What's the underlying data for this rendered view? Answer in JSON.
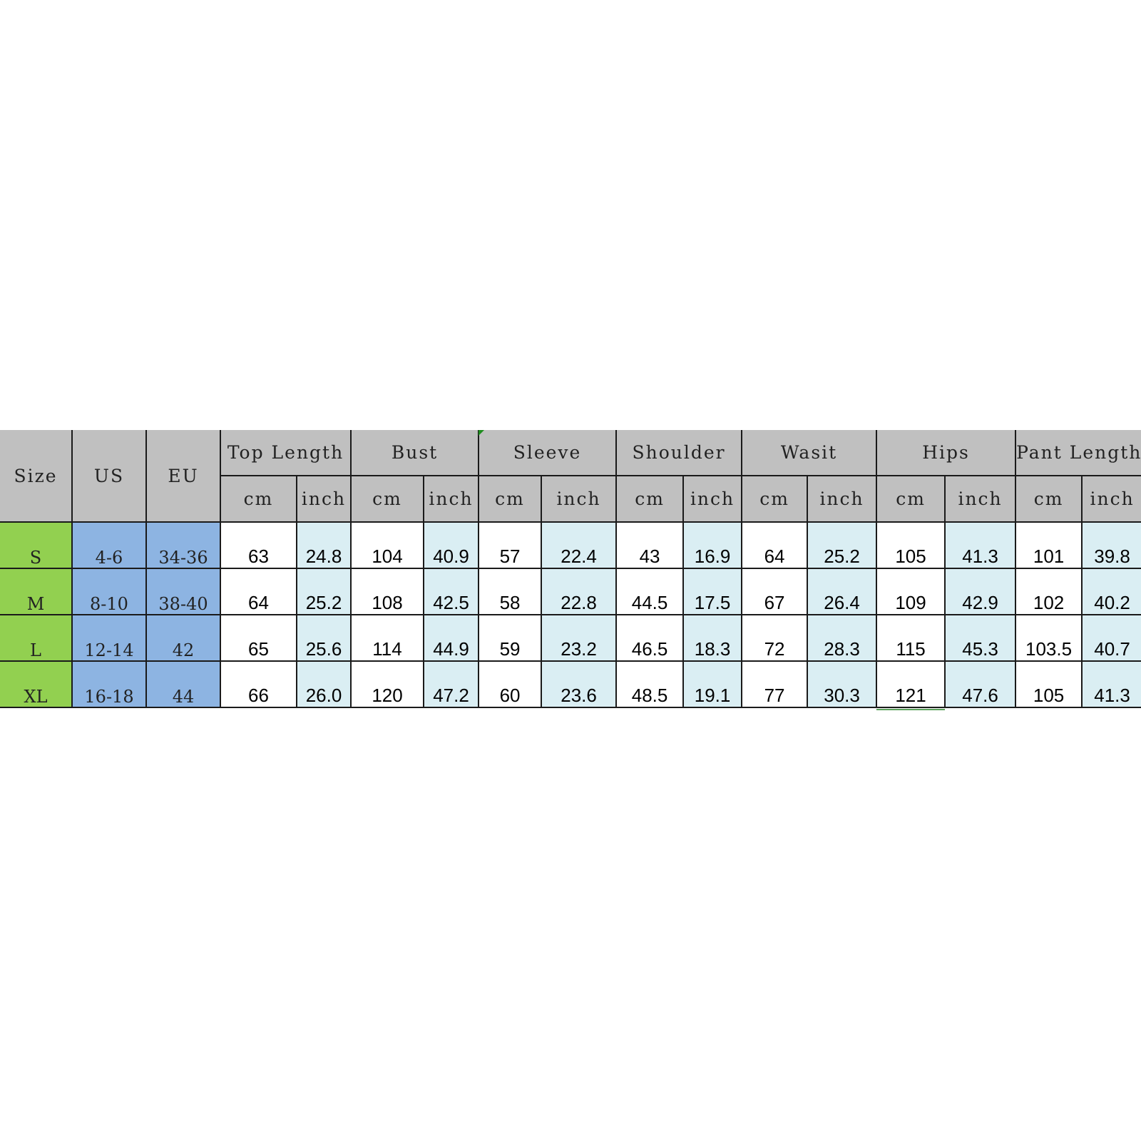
{
  "table": {
    "headers": {
      "size": "Size",
      "us": "US",
      "eu": "EU",
      "groups": [
        {
          "label": "Top Length",
          "sub": [
            "cm",
            "inch"
          ]
        },
        {
          "label": "Bust",
          "sub": [
            "cm",
            "inch"
          ]
        },
        {
          "label": "Sleeve",
          "sub": [
            "cm",
            "inch"
          ]
        },
        {
          "label": "Shoulder",
          "sub": [
            "cm",
            "inch"
          ]
        },
        {
          "label": "Wasit",
          "sub": [
            "cm",
            "inch"
          ]
        },
        {
          "label": "Hips",
          "sub": [
            "cm",
            "inch"
          ]
        },
        {
          "label": "Pant Length",
          "sub": [
            "cm",
            "inch"
          ]
        }
      ]
    },
    "rows": [
      {
        "size": "S",
        "us": "4-6",
        "eu": "34-36",
        "values": [
          "63",
          "24.8",
          "104",
          "40.9",
          "57",
          "22.4",
          "43",
          "16.9",
          "64",
          "25.2",
          "105",
          "41.3",
          "101",
          "39.8"
        ]
      },
      {
        "size": "M",
        "us": "8-10",
        "eu": "38-40",
        "values": [
          "64",
          "25.2",
          "108",
          "42.5",
          "58",
          "22.8",
          "44.5",
          "17.5",
          "67",
          "26.4",
          "109",
          "42.9",
          "102",
          "40.2"
        ]
      },
      {
        "size": "L",
        "us": "12-14",
        "eu": "42",
        "values": [
          "65",
          "25.6",
          "114",
          "44.9",
          "59",
          "23.2",
          "46.5",
          "18.3",
          "72",
          "28.3",
          "115",
          "45.3",
          "103.5",
          "40.7"
        ]
      },
      {
        "size": "XL",
        "us": "16-18",
        "eu": "44",
        "values": [
          "66",
          "26.0",
          "120",
          "47.2",
          "60",
          "23.6",
          "48.5",
          "19.1",
          "77",
          "30.3",
          "121",
          "47.6",
          "105",
          "41.3"
        ]
      }
    ]
  },
  "colors": {
    "header_bg": "#c0c0c0",
    "size_bg": "#92d050",
    "intl_bg": "#8db4e2",
    "cm_bg": "#ffffff",
    "inch_bg": "#daeef3"
  }
}
